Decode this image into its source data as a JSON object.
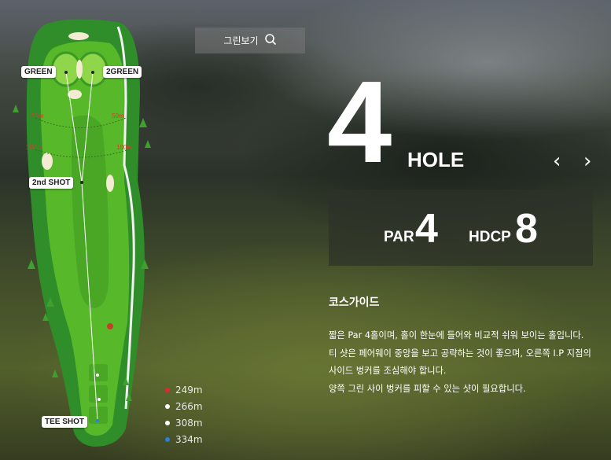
{
  "top_button": {
    "label": "그린보기",
    "icon": "search-icon"
  },
  "hole": {
    "number": "4",
    "word": "HOLE"
  },
  "navigation": {
    "prev_icon": "chevron-left-icon",
    "next_icon": "chevron-right-icon",
    "prev": "‹",
    "next": "›"
  },
  "stats": {
    "par_label": "PAR",
    "par_value": "4",
    "hdcp_label": "HDCP",
    "hdcp_value": "8"
  },
  "course_guide": {
    "title": "코스가이드",
    "lines": [
      "짧은 Par 4홀이며, 홀이 한눈에 들어와 비교적 쉬워 보이는 홀입니다.",
      "티 샷은 페어웨이 중앙을 보고 공략하는 것이 좋으며, 오른쪽 I.P 지점의",
      "사이드 벙커를 조심해야 합니다.",
      "양쪽 그린 사이 벙커를 피할 수 있는 샷이 필요합니다."
    ]
  },
  "map": {
    "labels": {
      "green": "GREEN",
      "green2": "2GREEN",
      "second_shot": "2nd SHOT",
      "tee_shot": "TEE SHOT"
    },
    "distances": {
      "left_50": "50m",
      "right_50": "50m",
      "left_100": "100m",
      "right_100": "100m"
    }
  },
  "tee_legend": [
    {
      "distance": "249m",
      "color": "#e02a2a"
    },
    {
      "distance": "266m",
      "color": "#ffffff"
    },
    {
      "distance": "308m",
      "color": "#ffffff"
    },
    {
      "distance": "334m",
      "color": "#2a7fe0"
    }
  ]
}
